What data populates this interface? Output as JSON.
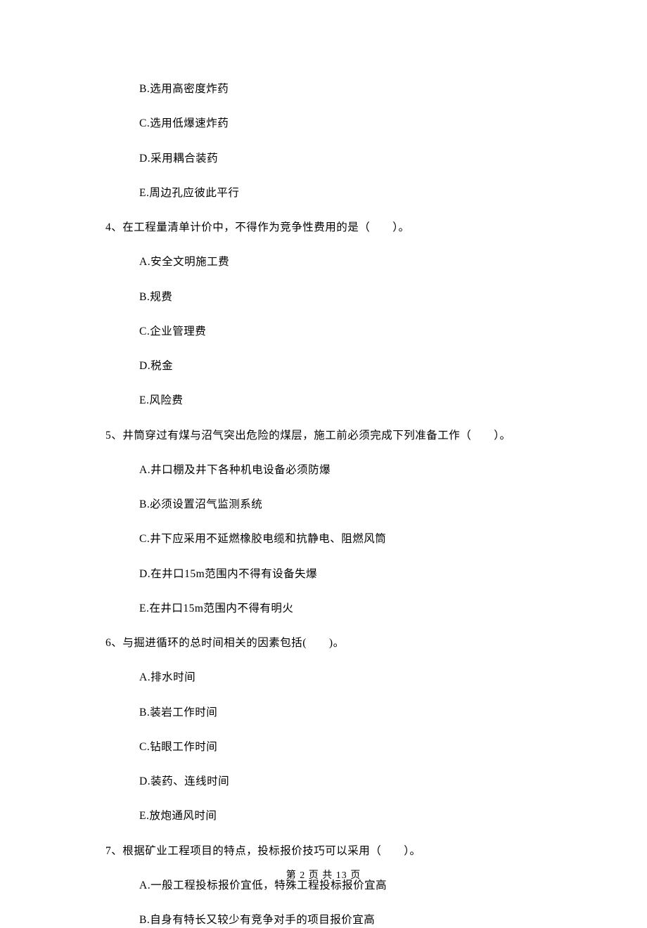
{
  "q3_options": {
    "b": "B.选用高密度炸药",
    "c": "C.选用低爆速炸药",
    "d": "D.采用耦合装药",
    "e": "E.周边孔应彼此平行"
  },
  "q4": {
    "stem": "4、在工程量清单计价中，不得作为竞争性费用的是（　　）。",
    "a": "A.安全文明施工费",
    "b": "B.规费",
    "c": "C.企业管理费",
    "d": "D.税金",
    "e": "E.风险费"
  },
  "q5": {
    "stem": "5、井筒穿过有煤与沼气突出危险的煤层，施工前必须完成下列准备工作（　　）。",
    "a": "A.井口棚及井下各种机电设备必须防爆",
    "b": "B.必须设置沼气监测系统",
    "c": "C.井下应采用不延燃橡胶电缆和抗静电、阻燃风筒",
    "d": "D.在井口15m范围内不得有设备失爆",
    "e": "E.在井口15m范围内不得有明火"
  },
  "q6": {
    "stem": "6、与掘进循环的总时间相关的因素包括(　　)。",
    "a": "A.排水时间",
    "b": "B.装岩工作时间",
    "c": "C.钻眼工作时间",
    "d": "D.装药、连线时间",
    "e": "E.放炮通风时间"
  },
  "q7": {
    "stem": "7、根据矿业工程项目的特点，投标报价技巧可以采用（　　）。",
    "a": "A.一般工程投标报价宜低，特殊工程投标报价宜高",
    "b": "B.自身有特长又较少有竞争对手的项目报价宜高"
  },
  "footer": "第 2 页 共 13 页"
}
